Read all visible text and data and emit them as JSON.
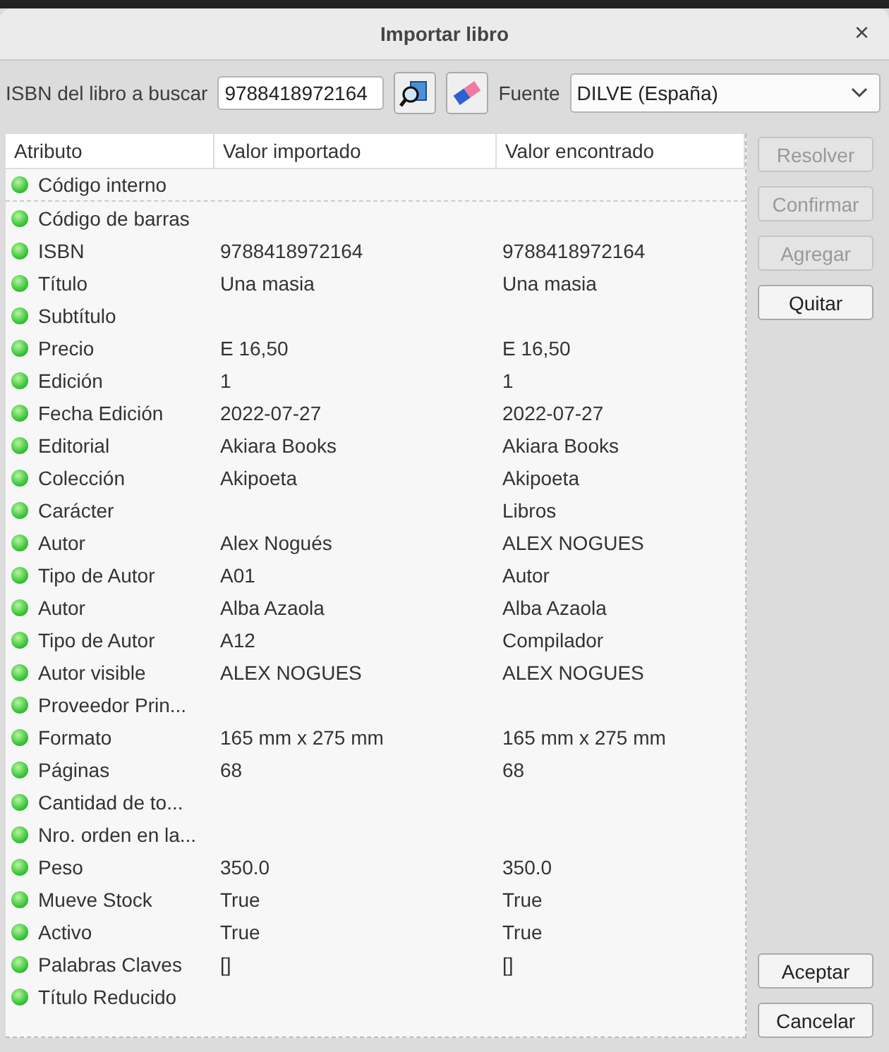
{
  "window": {
    "title": "Importar libro",
    "close": "×"
  },
  "search": {
    "label": "ISBN del libro a buscar",
    "value": "9788418972164",
    "source_label": "Fuente",
    "source": "DILVE (España)"
  },
  "table": {
    "columns": [
      "Atributo",
      "Valor importado",
      "Valor encontrado"
    ],
    "rows": [
      {
        "attribute": "Código interno",
        "imported": "",
        "found": ""
      },
      {
        "attribute": "Código de barras",
        "imported": "",
        "found": ""
      },
      {
        "attribute": "ISBN",
        "imported": "9788418972164",
        "found": "9788418972164"
      },
      {
        "attribute": "Título",
        "imported": "Una masia",
        "found": "Una masia"
      },
      {
        "attribute": "Subtítulo",
        "imported": "",
        "found": ""
      },
      {
        "attribute": "Precio",
        "imported": "E 16,50",
        "found": "E 16,50"
      },
      {
        "attribute": "Edición",
        "imported": "1",
        "found": "1"
      },
      {
        "attribute": "Fecha Edición",
        "imported": "2022-07-27",
        "found": "2022-07-27"
      },
      {
        "attribute": "Editorial",
        "imported": "Akiara Books",
        "found": "Akiara Books"
      },
      {
        "attribute": "Colección",
        "imported": "Akipoeta",
        "found": "Akipoeta"
      },
      {
        "attribute": "Carácter",
        "imported": "",
        "found": "Libros"
      },
      {
        "attribute": "Autor",
        "imported": "Alex Nogués",
        "found": "ALEX NOGUES"
      },
      {
        "attribute": "Tipo de Autor",
        "imported": "A01",
        "found": "Autor"
      },
      {
        "attribute": "Autor",
        "imported": "Alba Azaola",
        "found": "Alba Azaola"
      },
      {
        "attribute": "Tipo de Autor",
        "imported": "A12",
        "found": "Compilador"
      },
      {
        "attribute": "Autor visible",
        "imported": "ALEX NOGUES",
        "found": "ALEX NOGUES"
      },
      {
        "attribute": "Proveedor Prin...",
        "imported": "",
        "found": ""
      },
      {
        "attribute": "Formato",
        "imported": "165 mm x 275 mm",
        "found": "165 mm x 275 mm"
      },
      {
        "attribute": "Páginas",
        "imported": "68",
        "found": "68"
      },
      {
        "attribute": "Cantidad de to...",
        "imported": "",
        "found": ""
      },
      {
        "attribute": "Nro. orden en la...",
        "imported": "",
        "found": ""
      },
      {
        "attribute": "Peso",
        "imported": "350.0",
        "found": "350.0"
      },
      {
        "attribute": "Mueve Stock",
        "imported": "True",
        "found": "True"
      },
      {
        "attribute": "Activo",
        "imported": "True",
        "found": "True"
      },
      {
        "attribute": "Palabras Claves",
        "imported": "[]",
        "found": "[]"
      },
      {
        "attribute": "Título Reducido",
        "imported": "",
        "found": ""
      }
    ]
  },
  "side_buttons": [
    {
      "label": "Resolver",
      "disabled": true
    },
    {
      "label": "Confirmar",
      "disabled": true
    },
    {
      "label": "Agregar",
      "disabled": true
    },
    {
      "label": "Quitar",
      "disabled": false
    }
  ],
  "buttons": [
    "Aceptar",
    "Cancelar"
  ]
}
